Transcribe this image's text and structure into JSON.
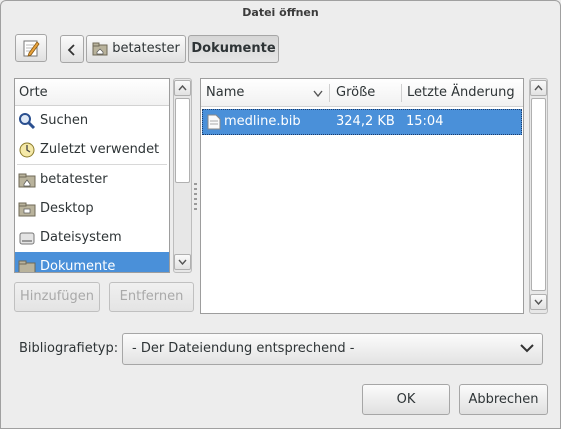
{
  "window": {
    "title": "Datei öffnen"
  },
  "toolbar": {
    "edit_icon": "pencil-edit-icon",
    "back_icon": "chevron-left-icon",
    "breadcrumbs": [
      {
        "label": "betatester",
        "icon": "home-folder-icon"
      },
      {
        "label": "Dokumente"
      }
    ]
  },
  "places": {
    "header": "Orte",
    "items": [
      {
        "label": "Suchen",
        "icon": "search-icon"
      },
      {
        "label": "Zuletzt verwendet",
        "icon": "recent-clock-icon"
      },
      {
        "label": "betatester",
        "icon": "home-folder-icon"
      },
      {
        "label": "Desktop",
        "icon": "desktop-folder-icon"
      },
      {
        "label": "Dateisystem",
        "icon": "drive-icon"
      },
      {
        "label": "Dokumente",
        "icon": "folder-icon",
        "selected": true
      }
    ],
    "add_button": "Hinzufügen",
    "remove_button": "Entfernen"
  },
  "files": {
    "columns": [
      "Name",
      "Größe",
      "Letzte Änderung"
    ],
    "rows": [
      {
        "name": "medline.bib",
        "size": "324,2 KB",
        "modified": "15:04",
        "selected": true
      }
    ]
  },
  "filter": {
    "label": "Bibliografietyp:",
    "selected": "- Der Dateiendung entsprechend -"
  },
  "buttons": {
    "ok": "OK",
    "cancel": "Abbrechen"
  },
  "colors": {
    "selection": "#4a90d9"
  }
}
